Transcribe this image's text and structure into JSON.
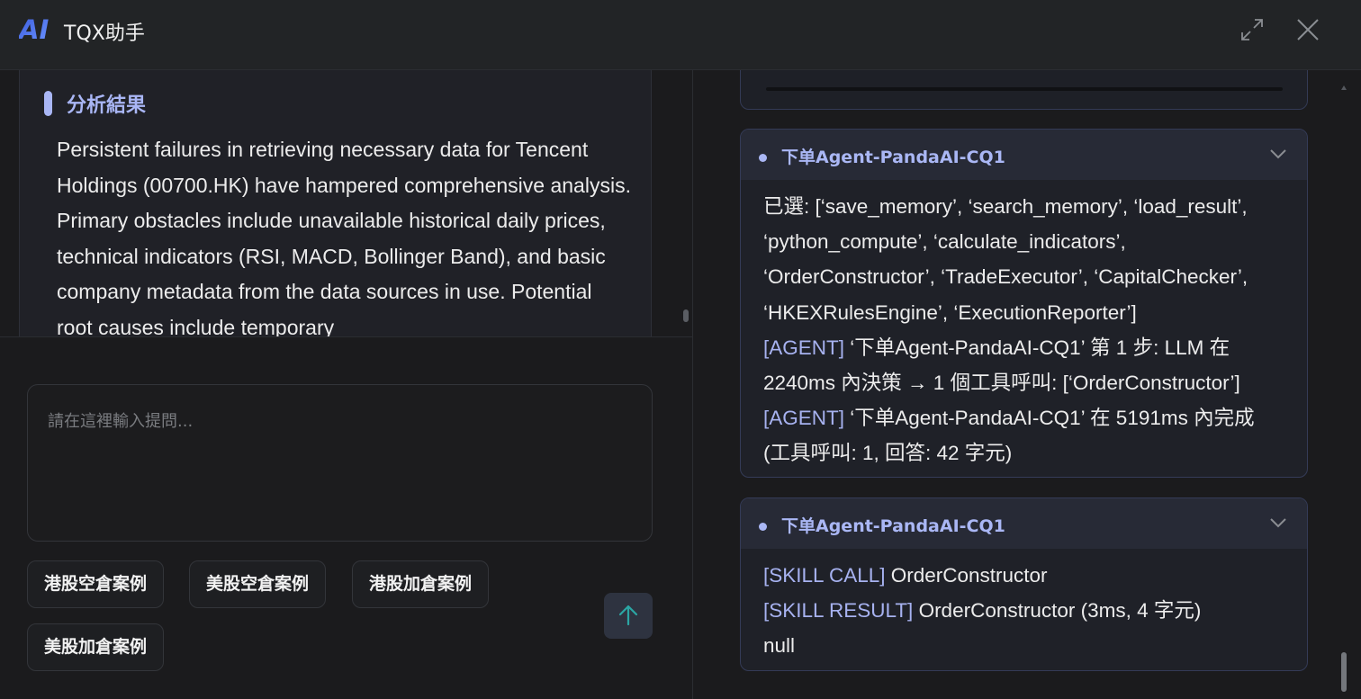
{
  "header": {
    "logo_text": "AI",
    "title": "TQX助手",
    "expand_icon": "expand-icon",
    "close_icon": "close-icon"
  },
  "left": {
    "result": {
      "title": "分析結果",
      "body": "Persistent failures in retrieving necessary data for Tencent Holdings (00700.HK) have hampered comprehensive analysis. Primary obstacles include unavailable historical daily prices, technical indicators (RSI, MACD, Bollinger Band), and basic company metadata from the data sources in use. Potential root causes include temporary"
    },
    "input": {
      "placeholder": "請在這裡輸入提問...",
      "value": ""
    },
    "chips": [
      "港股空倉案例",
      "美股空倉案例",
      "港股加倉案例",
      "美股加倉案例"
    ],
    "send_icon": "arrow-up-icon"
  },
  "right": {
    "cards": [
      {
        "name": "下单Agent-PandaAI-CQ1",
        "lines": [
          {
            "tag": "",
            "text": "已選: [‘save_memory’, ‘search_memory’, ‘load_result’, ‘python_compute’, ‘calculate_indicators’, ‘OrderConstructor’, ‘TradeExecutor’, ‘CapitalChecker’, ‘HKEXRulesEngine’, ‘ExecutionReporter’]"
          },
          {
            "tag": "[AGENT]",
            "text": " ‘下单Agent-PandaAI-CQ1’ 第 1 步: LLM 在 2240ms 內決策 → 1 個工具呼叫: [‘OrderConstructor’]"
          },
          {
            "tag": "[AGENT]",
            "text": " ‘下单Agent-PandaAI-CQ1’ 在 5191ms 內完成 (工具呼叫: 1, 回答: 42 字元)"
          }
        ]
      },
      {
        "name": "下单Agent-PandaAI-CQ1",
        "lines": [
          {
            "tag": "[SKILL CALL]",
            "text": " OrderConstructor"
          },
          {
            "tag": "[SKILL RESULT]",
            "text": " OrderConstructor (3ms, 4 字元)"
          },
          {
            "tag": "",
            "text": "null"
          }
        ]
      }
    ]
  },
  "colors": {
    "accent": "#a9b6f5",
    "background": "#1b1b1d",
    "header": "#222426",
    "logo_gradient_start": "#3b5bdb",
    "logo_gradient_end": "#5f8bff",
    "send_arrow": "#2ba6a4"
  }
}
